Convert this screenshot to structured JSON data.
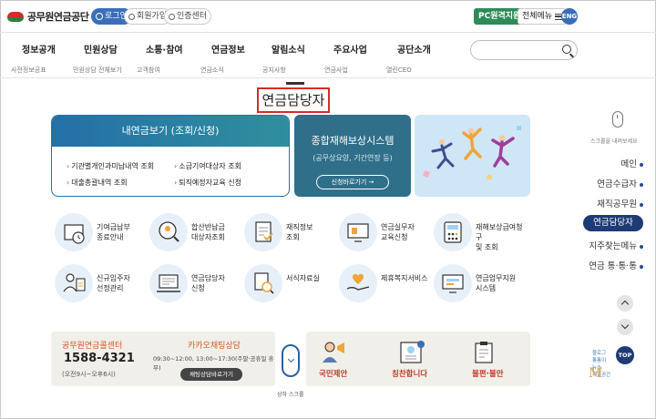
{
  "header": {
    "logo_text": "공무원연금공단",
    "login": "로그인",
    "join": "회원가입",
    "cert": "인증센터",
    "pc_support": "PC원격지원",
    "all_menu": "전체메뉴",
    "eng": "ENG"
  },
  "nav": {
    "items": [
      "정보공개",
      "민원상담",
      "소통·참여",
      "연금정보",
      "알림소식",
      "주요사업",
      "공단소개"
    ],
    "subs": [
      "사전정보공표",
      "민원상담 전체보기",
      "고객참여",
      "연금소식",
      "공지사항",
      "연금사업",
      "열린CEO"
    ]
  },
  "page_title": "연금담당자",
  "card1": {
    "title": "내연금보기 (조회/신청)",
    "links": [
      "기관별개인과미납내역 조회",
      "소급기여대상자 조회",
      "대출총괄내역 조회",
      "퇴직예정자교육 신청"
    ]
  },
  "card2": {
    "title": "종합재해보상시스템",
    "sub": "(공무상요양, 기간연장 등)",
    "button": "신청바로가기"
  },
  "services": [
    {
      "line1": "기여금납부",
      "line2": "종료안내"
    },
    {
      "line1": "합산반납금",
      "line2": "대상자조회"
    },
    {
      "line1": "재직정보",
      "line2": "조회"
    },
    {
      "line1": "연금실무자",
      "line2": "교육신청"
    },
    {
      "line1": "재해보상급여청구",
      "line2": "및 조회"
    },
    {
      "line1": "신규임주자",
      "line2": "선정관리"
    },
    {
      "line1": "연금담당자",
      "line2": "신청"
    },
    {
      "line1": "서식자료실",
      "line2": ""
    },
    {
      "line1": "제휴복지서비스",
      "line2": ""
    },
    {
      "line1": "연금업무지원",
      "line2": "시스템"
    }
  ],
  "callcenter": {
    "title": "공무원연금콜센터",
    "number": "1588-4321",
    "hours": "(오전9시~오후6시)"
  },
  "kakao": {
    "title": "카카오채팅상담",
    "hours": "09:30~12:00, 13:00~17:30(주말·공휴일 휴무)",
    "button": "채팅상담바로가기"
  },
  "scroll_label": "상하 스크롤",
  "bottom_right": [
    "국민제안",
    "칭찬합니다",
    "불편·불만"
  ],
  "rail": {
    "mouse_label": "스크롤을 내려보세요",
    "items": [
      "메인",
      "연금수급자",
      "재직공무원",
      "연금담당자",
      "지주찾는메뉴",
      "연금 통·통·통"
    ],
    "active": "연금담당자",
    "top": "TOP",
    "mascot": [
      "블로그",
      "통통이",
      "뉴스",
      "체험공간"
    ],
    "mascot_tag": "M"
  },
  "colors": {
    "primary": "#3a6fb8",
    "card_teal": "#2f6f8a",
    "accent_red": "#d62b2b",
    "rail_active": "#1f3b73",
    "green": "#2e8b57"
  }
}
